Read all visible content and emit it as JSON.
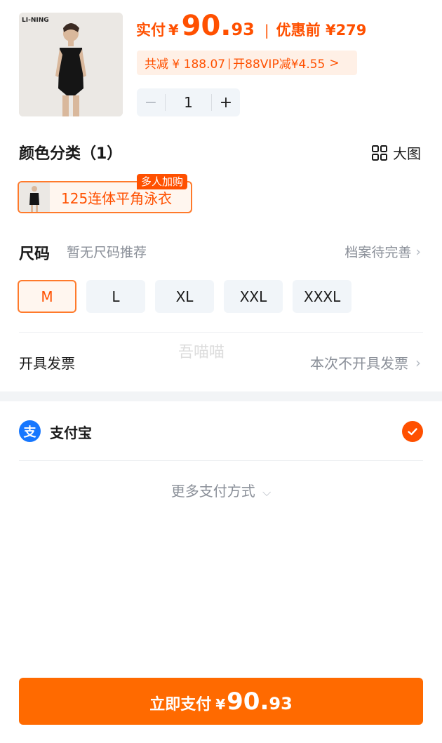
{
  "product": {
    "brand_logo": "LI-NING",
    "price_label": "实付",
    "currency": "¥",
    "price_int": "90.",
    "price_dec": "93",
    "separator": "|",
    "original_label": "优惠前 ¥279",
    "discount_total": "共减 ¥ 188.07",
    "discount_bar": "|",
    "discount_vip": "开88VIP减¥4.55",
    "discount_chevron": ">",
    "quantity": "1",
    "minus": "−",
    "plus": "+"
  },
  "color_section": {
    "title": "颜色分类（1）",
    "view_big_label": "大图",
    "option_name": "125连体平角泳衣",
    "group_tag": "多人加购"
  },
  "size_section": {
    "title": "尺码",
    "hint": "暂无尺码推荐",
    "profile_link": "档案待完善",
    "chevron": "›",
    "sizes": [
      "M",
      "L",
      "XL",
      "XXL",
      "XXXL"
    ],
    "selected_size": "M"
  },
  "invoice": {
    "label": "开具发票",
    "value": "本次不开具发票",
    "chevron": "›"
  },
  "watermark": "吾喵喵",
  "payment": {
    "method_icon": "支",
    "method_label": "支付宝",
    "more_label": "更多支付方式",
    "more_chevron": "⌵"
  },
  "pay_button": {
    "label": "立即支付",
    "currency": "¥",
    "price_int": "90.",
    "price_dec": "93"
  },
  "colors": {
    "accent": "#ff5000",
    "button": "#ff6a00",
    "alipay": "#1677ff",
    "muted": "#8a8f98"
  }
}
